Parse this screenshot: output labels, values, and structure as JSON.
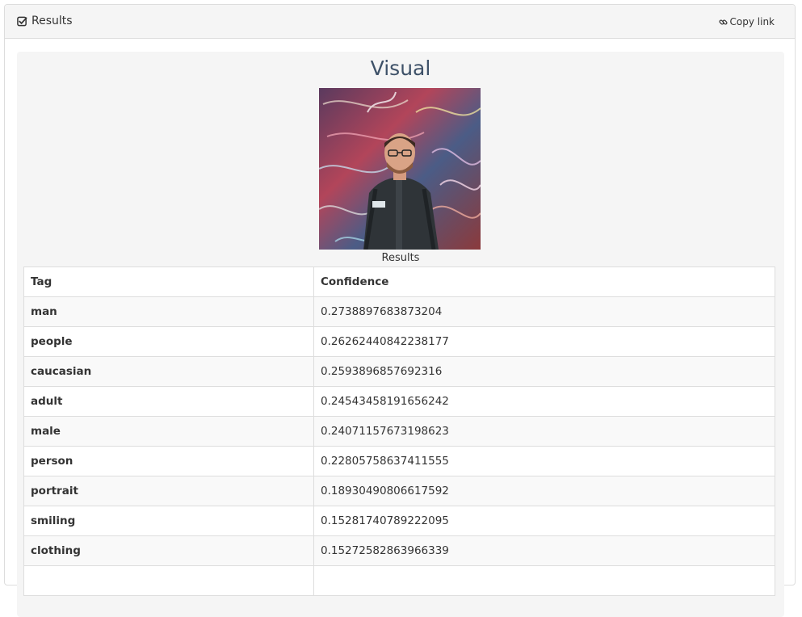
{
  "panel": {
    "title": "Results",
    "copy_link_label": "Copy link"
  },
  "visual": {
    "title": "Visual",
    "caption": "Results"
  },
  "table": {
    "headers": {
      "tag": "Tag",
      "confidence": "Confidence"
    },
    "rows": [
      {
        "tag": "man",
        "confidence": "0.2738897683873204"
      },
      {
        "tag": "people",
        "confidence": "0.26262440842238177"
      },
      {
        "tag": "caucasian",
        "confidence": "0.2593896857692316"
      },
      {
        "tag": "adult",
        "confidence": "0.24543458191656242"
      },
      {
        "tag": "male",
        "confidence": "0.2407115767319862​3"
      },
      {
        "tag": "person",
        "confidence": "0.22805758637411555"
      },
      {
        "tag": "portrait",
        "confidence": "0.18930490806617592"
      },
      {
        "tag": "smiling",
        "confidence": "0.15281740789222095"
      },
      {
        "tag": "clothing",
        "confidence": "0.15272582863966339"
      },
      {
        "tag": "",
        "confidence": ""
      }
    ]
  },
  "icons": {
    "title": "check-square-icon",
    "copy": "link-icon"
  },
  "colors": {
    "heading_bg": "#f5f5f5",
    "border": "#dddddd",
    "visual_title": "#3e5168"
  }
}
